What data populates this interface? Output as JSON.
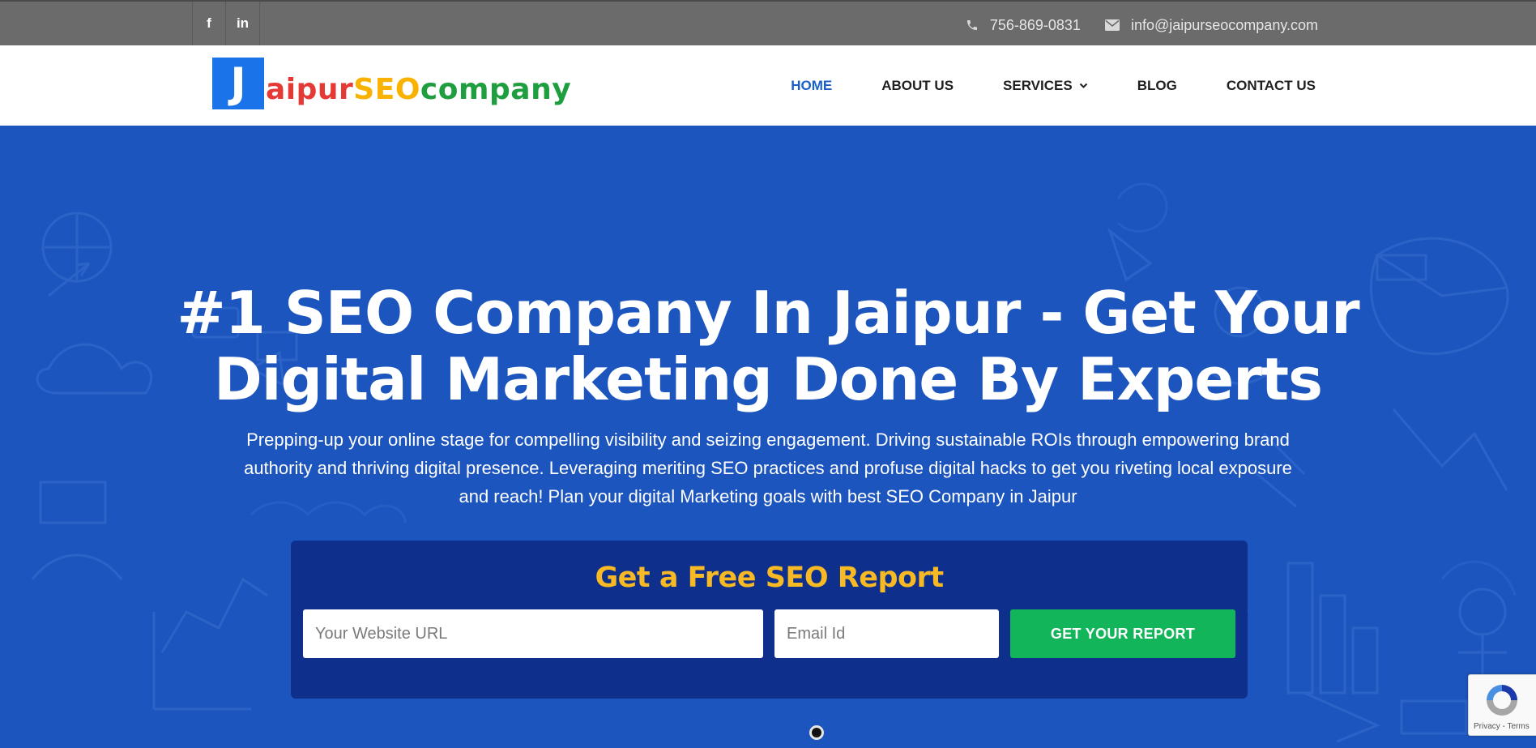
{
  "topbar": {
    "social": [
      {
        "icon": "facebook-icon",
        "label": "f"
      },
      {
        "icon": "linkedin-icon",
        "label": "in"
      }
    ],
    "phone": "756-869-0831",
    "email": "info@jaipurseocompany.com"
  },
  "header": {
    "logo": {
      "mark": "J",
      "part1": "aipur",
      "part2": "SEO",
      "part3": "company"
    },
    "nav": [
      {
        "label": "HOME",
        "active": true
      },
      {
        "label": "ABOUT US"
      },
      {
        "label": "SERVICES",
        "has_dropdown": true
      },
      {
        "label": "BLOG"
      },
      {
        "label": "CONTACT US"
      }
    ]
  },
  "hero": {
    "title_line1": "#1 SEO Company In Jaipur - Get Your",
    "title_line2": "Digital Marketing Done By Experts",
    "description_line1": "Prepping-up your online stage for compelling visibility and seizing engagement. Driving sustainable ROIs through empowering brand",
    "description_line2": "authority and thriving digital presence. Leveraging meriting SEO practices and profuse digital hacks to get you riveting local exposure",
    "description_line3": "and reach! Plan your digital Marketing goals with best SEO Company in Jaipur"
  },
  "report_form": {
    "title": "Get a Free SEO Report",
    "url_placeholder": "Your Website URL",
    "email_placeholder": "Email Id",
    "button_label": "GET YOUR REPORT"
  },
  "recaptcha": {
    "terms": "Privacy - Terms"
  },
  "colors": {
    "topbar": "#6b6b6b",
    "hero_blue": "#1c55be",
    "form_navy": "#0e2f8c",
    "accent_yellow": "#f7b924",
    "button_green": "#12b55a",
    "nav_active": "#1a5fc9"
  }
}
